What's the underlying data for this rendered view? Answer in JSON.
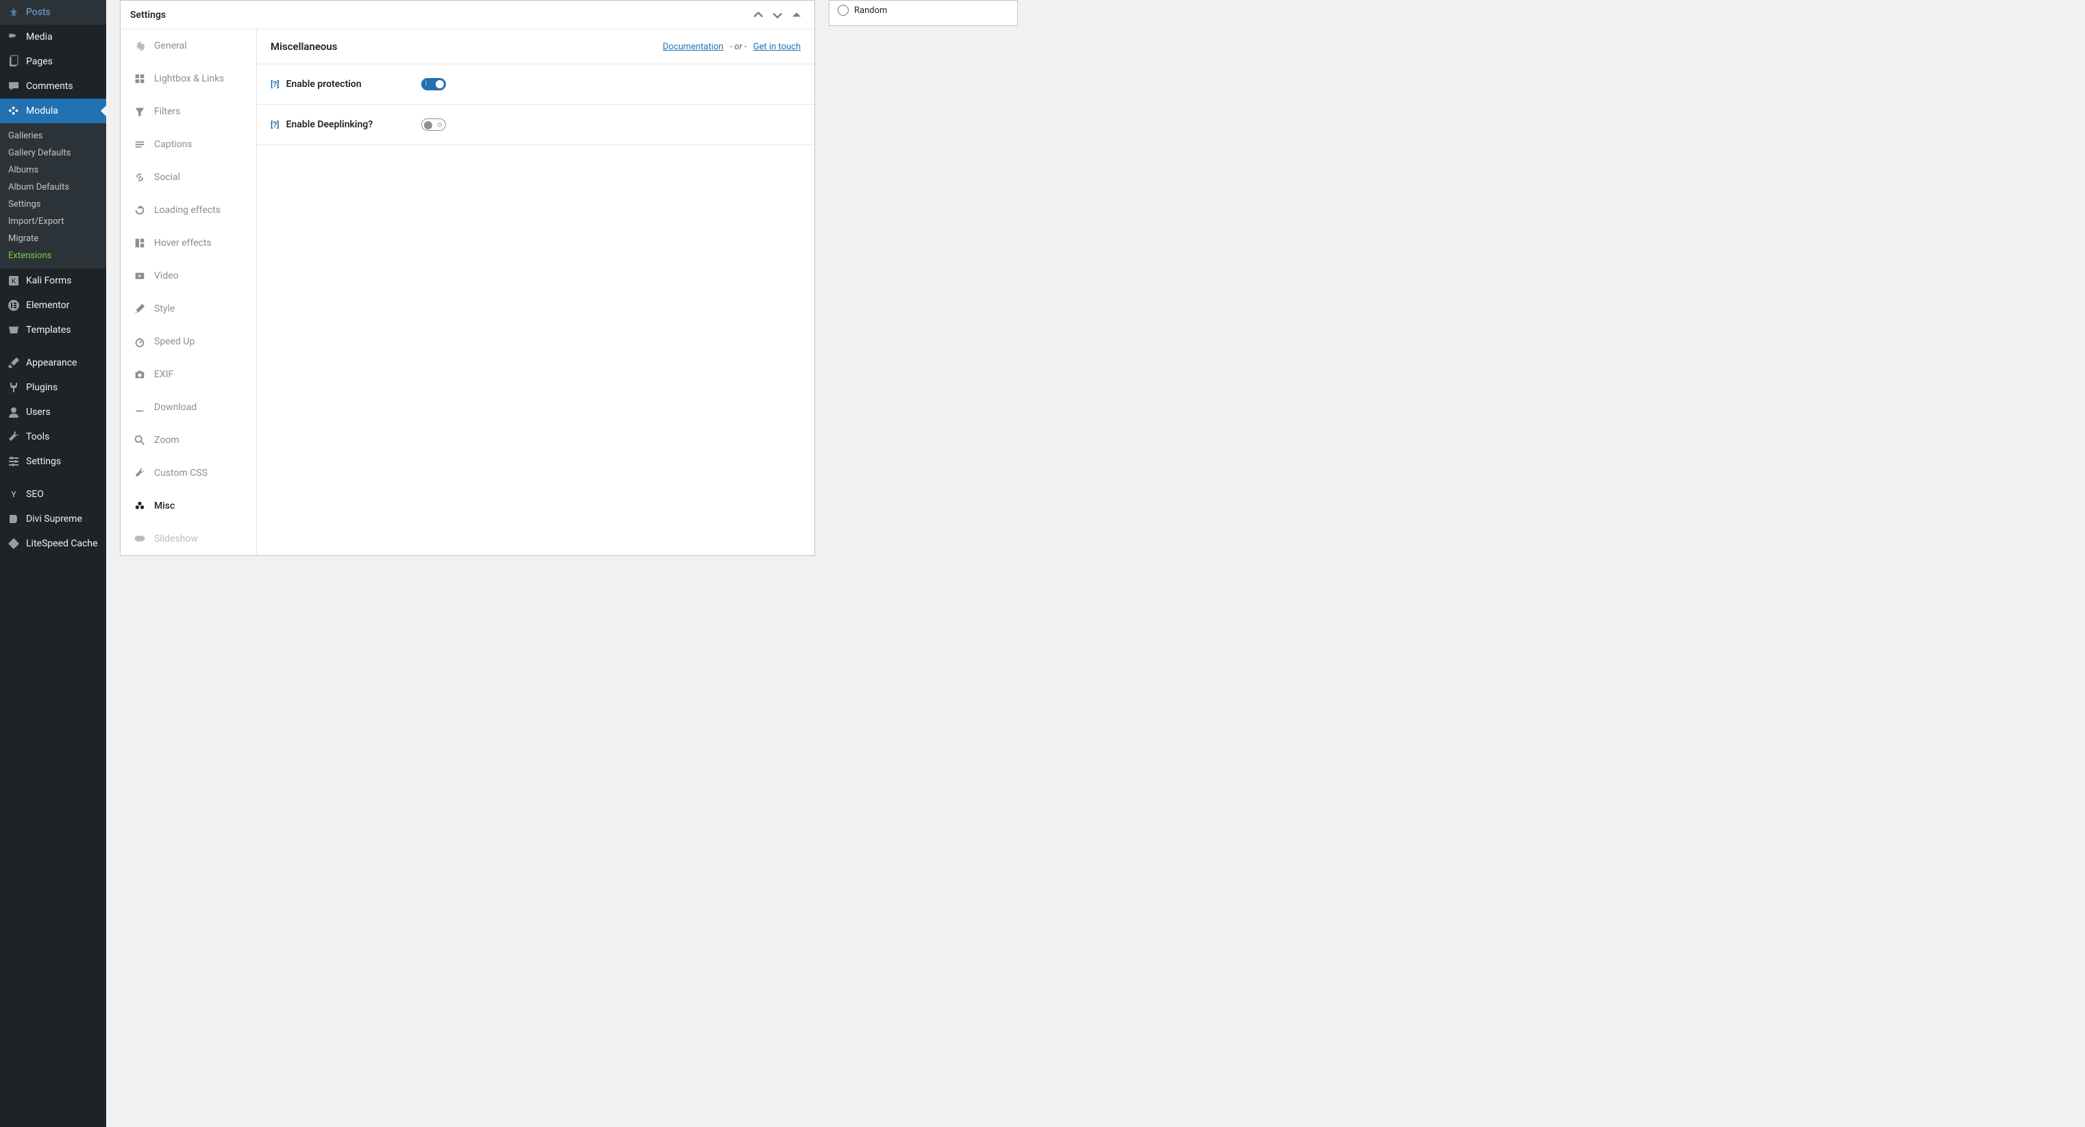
{
  "wp_sidebar": {
    "items": [
      {
        "label": "Posts",
        "icon": "pin"
      },
      {
        "label": "Media",
        "icon": "media"
      },
      {
        "label": "Pages",
        "icon": "pages"
      },
      {
        "label": "Comments",
        "icon": "comment"
      },
      {
        "label": "Modula",
        "icon": "modula",
        "current": true,
        "submenu": [
          "Galleries",
          "Gallery Defaults",
          "Albums",
          "Album Defaults",
          "Settings",
          "Import/Export",
          "Migrate"
        ],
        "submenu_ext": "Extensions"
      },
      {
        "label": "Kali Forms",
        "icon": "kali"
      },
      {
        "label": "Elementor",
        "icon": "elementor"
      },
      {
        "label": "Templates",
        "icon": "templates"
      },
      {
        "label": "Appearance",
        "icon": "brush"
      },
      {
        "label": "Plugins",
        "icon": "plug"
      },
      {
        "label": "Users",
        "icon": "user"
      },
      {
        "label": "Tools",
        "icon": "wrench"
      },
      {
        "label": "Settings",
        "icon": "sliders"
      },
      {
        "label": "SEO",
        "icon": "seo"
      },
      {
        "label": "Divi Supreme",
        "icon": "divi"
      },
      {
        "label": "LiteSpeed Cache",
        "icon": "litespeed"
      }
    ]
  },
  "settings_box": {
    "title": "Settings",
    "tabs": [
      {
        "label": "General",
        "icon": "gear"
      },
      {
        "label": "Lightbox & Links",
        "icon": "lightbox"
      },
      {
        "label": "Filters",
        "icon": "filter"
      },
      {
        "label": "Captions",
        "icon": "captions"
      },
      {
        "label": "Social",
        "icon": "link"
      },
      {
        "label": "Loading effects",
        "icon": "reload"
      },
      {
        "label": "Hover effects",
        "icon": "hover"
      },
      {
        "label": "Video",
        "icon": "video"
      },
      {
        "label": "Style",
        "icon": "style"
      },
      {
        "label": "Speed Up",
        "icon": "speed"
      },
      {
        "label": "EXIF",
        "icon": "camera"
      },
      {
        "label": "Download",
        "icon": "download"
      },
      {
        "label": "Zoom",
        "icon": "zoom"
      },
      {
        "label": "Custom CSS",
        "icon": "wrench2"
      },
      {
        "label": "Misc",
        "icon": "misc",
        "active": true
      },
      {
        "label": "Slideshow",
        "icon": "slideshow",
        "faded": true
      }
    ],
    "panel": {
      "heading": "Miscellaneous",
      "doc_link": "Documentation",
      "or_text": "- or -",
      "touch_link": "Get in touch",
      "help_badge": "[?]",
      "rows": [
        {
          "label": "Enable protection",
          "on": true
        },
        {
          "label": "Enable Deeplinking?",
          "on": false
        }
      ]
    }
  },
  "side_box": {
    "radios": [
      "Random"
    ]
  }
}
